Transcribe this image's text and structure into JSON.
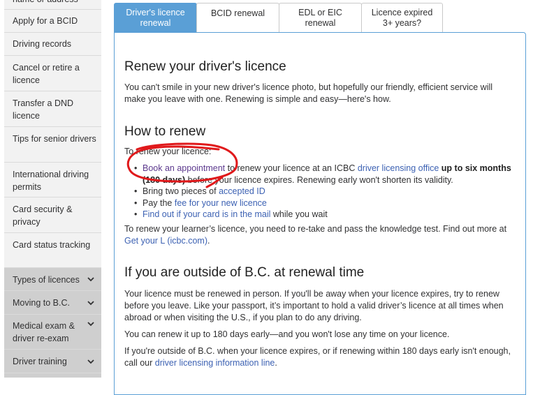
{
  "sidebar": {
    "items": [
      {
        "label": "name or address"
      },
      {
        "label": "Apply for a BCID"
      },
      {
        "label": "Driving records"
      },
      {
        "label": "Cancel or retire a licence"
      },
      {
        "label": "Transfer a DND licence"
      },
      {
        "label": "Tips for senior drivers"
      },
      {
        "label": "International driving permits"
      },
      {
        "label": "Card security & privacy"
      },
      {
        "label": "Card status tracking"
      }
    ],
    "sections": [
      {
        "label": "Types of licences"
      },
      {
        "label": "Moving to B.C."
      },
      {
        "label": "Medical exam & driver re-exam"
      },
      {
        "label": "Driver training"
      }
    ]
  },
  "tabs": [
    {
      "label": "Driver's licence renewal"
    },
    {
      "label": "BCID renewal"
    },
    {
      "label": "EDL or EIC renewal"
    },
    {
      "label": "Licence expired 3+ years?"
    }
  ],
  "main": {
    "title": "Renew your driver's licence",
    "intro": "You can't smile in your new driver's licence photo, but hopefully our friendly, efficient service will make you leave with one. Renewing is simple and easy—here's how.",
    "how_heading": "How to renew",
    "how_lead": "To renew your licence:",
    "bullets": {
      "b1_link": "Book an appointment",
      "b1_text1": " to renew your licence at an ICBC ",
      "b1_link2": "driver licensing office",
      "b1_bold": " up to six months (180 days)",
      "b1_text2": " before your licence expires. Renewing early won't shorten its validity.",
      "b2_text": "Bring two pieces of ",
      "b2_link": "accepted ID",
      "b3_text": "Pay the ",
      "b3_link": "fee for your new licence",
      "b4_link": "Find out if your card is in the mail",
      "b4_text": " while you wait"
    },
    "learner_text": "To renew your learner’s licence, you need to re-take and pass the knowledge test. Find out more at ",
    "learner_link": "Get your L (icbc.com)",
    "learner_end": ".",
    "outside_heading": "If you are outside of B.C. at renewal time",
    "outside_p1": "Your licence must be renewed in person. If you'll be away when your licence expires, try to renew before you leave. Like your passport, it’s important to hold a valid driver’s licence at all times when abroad or when visiting the U.S., if you plan to do any driving.",
    "outside_p2": "You can renew it up to 180 days early—and you won't lose any time on your licence.",
    "outside_p3_text": "If you're outside of B.C. when your licence expires, or if renewing within 180 days early isn't enough, call our ",
    "outside_p3_link": "driver licensing information line",
    "outside_p3_end": "."
  },
  "colors": {
    "accent": "#5a9fd6",
    "link": "#3d62b3",
    "visited_link": "#5d3a8e",
    "annotation": "#e0191b",
    "sidebar_bg": "#f2f2f2",
    "sidebar_section_bg": "#cfcfcf"
  }
}
